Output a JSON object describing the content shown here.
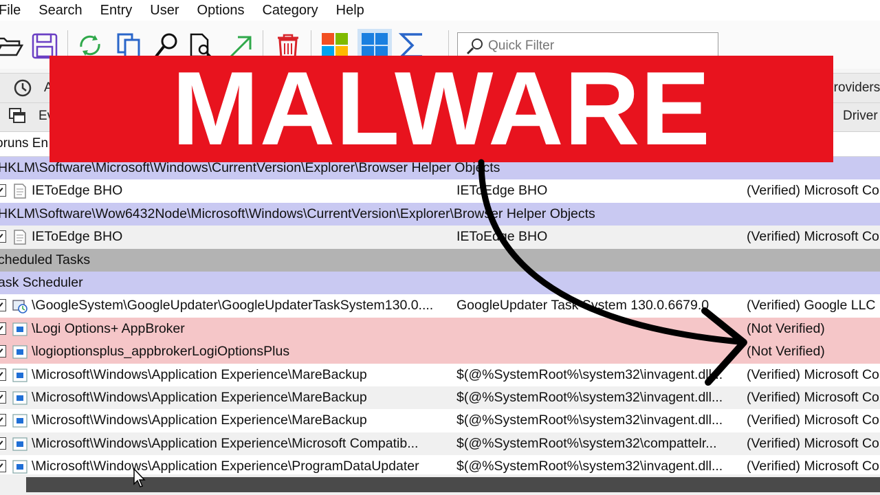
{
  "menu": [
    "File",
    "Search",
    "Entry",
    "User",
    "Options",
    "Category",
    "Help"
  ],
  "toolbar": {
    "quick_filter_placeholder": "Quick Filter",
    "icons": [
      "open-icon",
      "save-icon",
      "refresh-icon",
      "copy-icon",
      "find-icon",
      "find-file-icon",
      "jump-icon",
      "delete-icon",
      "windows-icon",
      "windows-tiles-icon",
      "sigma-icon"
    ]
  },
  "tabs": {
    "row1_left": "A",
    "row1_right": "Providers",
    "row2_left": "Ev",
    "row2_right": "Driver"
  },
  "column_header": {
    "entry": "oruns En"
  },
  "banner": {
    "text": "MALWARE",
    "color": "#e8131e"
  },
  "rows": [
    {
      "type": "key",
      "text": "HKLM\\Software\\Microsoft\\Windows\\CurrentVersion\\Explorer\\Browser Helper Objects"
    },
    {
      "type": "normal",
      "icon": "bho-icon",
      "entry": "IEToEdge BHO",
      "description": "IEToEdge BHO",
      "publisher": "(Verified) Microsoft Co"
    },
    {
      "type": "key",
      "text": "HKLM\\Software\\Wow6432Node\\Microsoft\\Windows\\CurrentVersion\\Explorer\\Browser Helper Objects"
    },
    {
      "type": "normal",
      "icon": "bho-icon",
      "entry": "IEToEdge BHO",
      "description": "IEToEdge BHO",
      "publisher": "(Verified) Microsoft Co"
    },
    {
      "type": "section",
      "text": "cheduled Tasks"
    },
    {
      "type": "key",
      "text": "ask Scheduler"
    },
    {
      "type": "normal",
      "icon": "google-task-icon",
      "entry": "\\GoogleSystem\\GoogleUpdater\\GoogleUpdaterTaskSystem130.0....",
      "description": "GoogleUpdater Task System 130.0.6679.0",
      "publisher": "(Verified) Google LLC"
    },
    {
      "type": "unverified",
      "icon": "task-icon",
      "entry": "\\Logi Options+ AppBroker",
      "description": "",
      "publisher": "(Not Verified)"
    },
    {
      "type": "unverified",
      "icon": "task-icon",
      "entry": "\\logioptionsplus_appbrokerLogiOptionsPlus",
      "description": "",
      "publisher": "(Not Verified)"
    },
    {
      "type": "normal",
      "icon": "task-icon",
      "entry": "\\Microsoft\\Windows\\Application Experience\\MareBackup",
      "description": "$(@%SystemRoot%\\system32\\invagent.dll...",
      "publisher": "(Verified) Microsoft Co"
    },
    {
      "type": "alt",
      "icon": "task-icon",
      "entry": "\\Microsoft\\Windows\\Application Experience\\MareBackup",
      "description": "$(@%SystemRoot%\\system32\\invagent.dll...",
      "publisher": "(Verified) Microsoft Co"
    },
    {
      "type": "normal",
      "icon": "task-icon",
      "entry": "\\Microsoft\\Windows\\Application Experience\\MareBackup",
      "description": "$(@%SystemRoot%\\system32\\invagent.dll...",
      "publisher": "(Verified) Microsoft Co"
    },
    {
      "type": "alt",
      "icon": "task-icon",
      "entry": "\\Microsoft\\Windows\\Application Experience\\Microsoft Compatib...",
      "description": "$(@%SystemRoot%\\system32\\compattelr...",
      "publisher": "(Verified) Microsoft Co"
    },
    {
      "type": "normal",
      "icon": "task-icon",
      "entry": "\\Microsoft\\Windows\\Application Experience\\ProgramDataUpdater",
      "description": "$(@%SystemRoot%\\system32\\invagent.dll...",
      "publisher": "(Verified) Microsoft Co"
    }
  ]
}
